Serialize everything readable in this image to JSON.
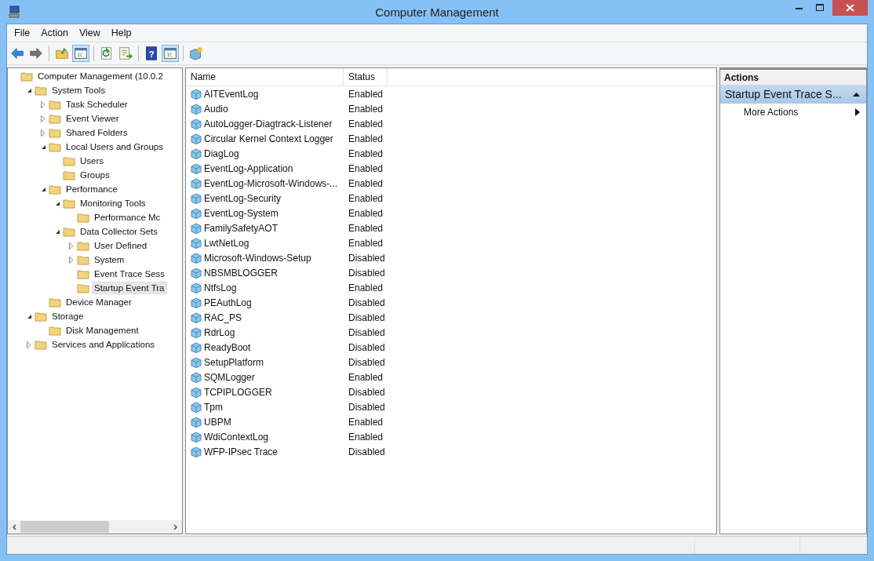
{
  "window": {
    "title": "Computer Management"
  },
  "menu": [
    "File",
    "Action",
    "View",
    "Help"
  ],
  "toolbar": [
    {
      "kind": "back",
      "pressed": false
    },
    {
      "kind": "forward",
      "pressed": false
    },
    {
      "kind": "separator"
    },
    {
      "kind": "up",
      "pressed": false
    },
    {
      "kind": "pane",
      "pressed": true
    },
    {
      "kind": "separator"
    },
    {
      "kind": "refresh",
      "pressed": false
    },
    {
      "kind": "export",
      "pressed": false
    },
    {
      "kind": "separator"
    },
    {
      "kind": "help",
      "pressed": false,
      "glyph": "?"
    },
    {
      "kind": "pane",
      "pressed": true
    },
    {
      "kind": "separator"
    },
    {
      "kind": "cube",
      "pressed": false
    }
  ],
  "tree": [
    {
      "label": "Computer Management (10.0.2",
      "selected": false,
      "children": [
        {
          "label": "System Tools",
          "expanded": true,
          "selected": false,
          "children": [
            {
              "label": "Task Scheduler",
              "expanded": false,
              "selected": false
            },
            {
              "label": "Event Viewer",
              "expanded": false,
              "selected": false
            },
            {
              "label": "Shared Folders",
              "expanded": false,
              "selected": false
            },
            {
              "label": "Local Users and Groups",
              "expanded": true,
              "selected": false,
              "children": [
                {
                  "label": "Users",
                  "selected": false
                },
                {
                  "label": "Groups",
                  "selected": false
                }
              ]
            },
            {
              "label": "Performance",
              "expanded": true,
              "selected": false,
              "children": [
                {
                  "label": "Monitoring Tools",
                  "expanded": true,
                  "selected": false,
                  "children": [
                    {
                      "label": "Performance Mc",
                      "selected": false
                    }
                  ]
                },
                {
                  "label": "Data Collector Sets",
                  "expanded": true,
                  "selected": false,
                  "children": [
                    {
                      "label": "User Defined",
                      "expanded": false,
                      "selected": false
                    },
                    {
                      "label": "System",
                      "expanded": false,
                      "selected": false
                    },
                    {
                      "label": "Event Trace Sess",
                      "selected": false
                    },
                    {
                      "label": "Startup Event Tra",
                      "selected": true
                    }
                  ]
                }
              ]
            },
            {
              "label": "Device Manager",
              "selected": false
            }
          ]
        },
        {
          "label": "Storage",
          "expanded": true,
          "selected": false,
          "children": [
            {
              "label": "Disk Management",
              "selected": false
            }
          ]
        },
        {
          "label": "Services and Applications",
          "expanded": false,
          "selected": false
        }
      ]
    }
  ],
  "table": {
    "columns": [
      "Name",
      "Status"
    ],
    "rows": [
      {
        "name": "AITEventLog",
        "status": "Enabled"
      },
      {
        "name": "Audio",
        "status": "Enabled"
      },
      {
        "name": "AutoLogger-Diagtrack-Listener",
        "status": "Enabled"
      },
      {
        "name": "Circular Kernel Context Logger",
        "status": "Enabled"
      },
      {
        "name": "DiagLog",
        "status": "Enabled"
      },
      {
        "name": "EventLog-Application",
        "status": "Enabled"
      },
      {
        "name": "EventLog-Microsoft-Windows-...",
        "status": "Enabled"
      },
      {
        "name": "EventLog-Security",
        "status": "Enabled"
      },
      {
        "name": "EventLog-System",
        "status": "Enabled"
      },
      {
        "name": "FamilySafetyAOT",
        "status": "Enabled"
      },
      {
        "name": "LwtNetLog",
        "status": "Enabled"
      },
      {
        "name": "Microsoft-Windows-Setup",
        "status": "Disabled"
      },
      {
        "name": "NBSMBLOGGER",
        "status": "Disabled"
      },
      {
        "name": "NtfsLog",
        "status": "Enabled"
      },
      {
        "name": "PEAuthLog",
        "status": "Disabled"
      },
      {
        "name": "RAC_PS",
        "status": "Disabled"
      },
      {
        "name": "RdrLog",
        "status": "Disabled"
      },
      {
        "name": "ReadyBoot",
        "status": "Disabled"
      },
      {
        "name": "SetupPlatform",
        "status": "Disabled"
      },
      {
        "name": "SQMLogger",
        "status": "Enabled"
      },
      {
        "name": "TCPIPLOGGER",
        "status": "Disabled"
      },
      {
        "name": "Tpm",
        "status": "Disabled"
      },
      {
        "name": "UBPM",
        "status": "Enabled"
      },
      {
        "name": "WdiContextLog",
        "status": "Enabled"
      },
      {
        "name": "WFP-IPsec Trace",
        "status": "Disabled"
      }
    ]
  },
  "actions": {
    "title": "Actions",
    "section": "Startup Event Trace S...",
    "items": [
      "More Actions"
    ]
  }
}
